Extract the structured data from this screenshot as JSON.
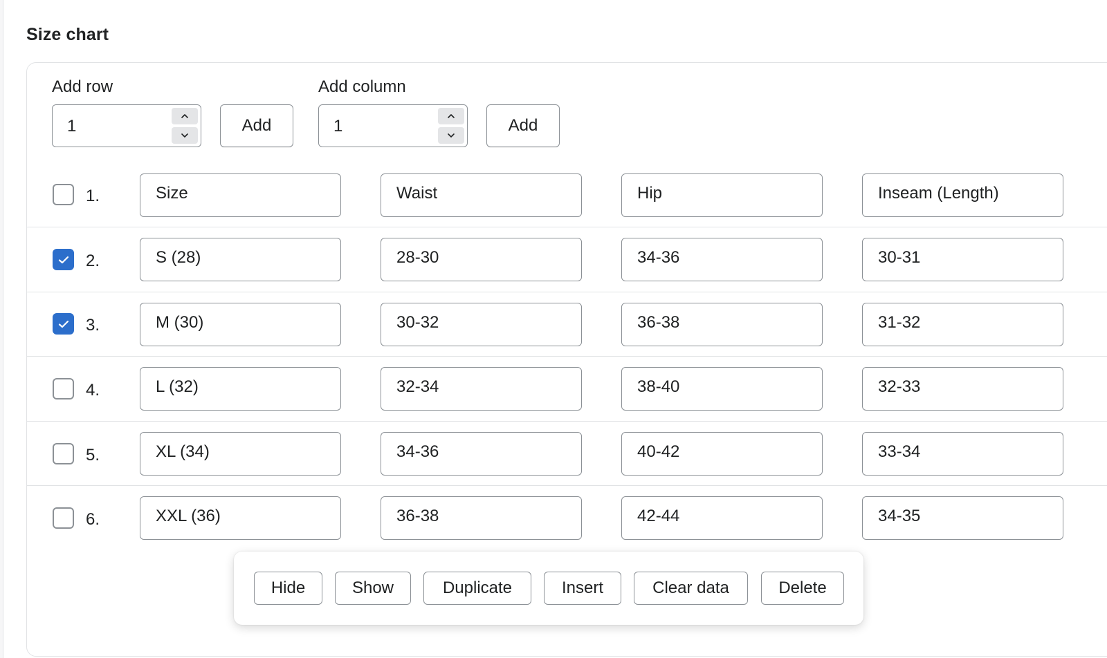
{
  "section_title": "Size chart",
  "controls": {
    "add_row": {
      "label": "Add row",
      "value": "1",
      "button": "Add"
    },
    "add_column": {
      "label": "Add column",
      "value": "1",
      "button": "Add"
    }
  },
  "table": {
    "rows": [
      {
        "num": "1.",
        "checked": false,
        "cells": [
          "Size",
          "Waist",
          "Hip",
          "Inseam (Length)"
        ]
      },
      {
        "num": "2.",
        "checked": true,
        "cells": [
          "S (28)",
          "28-30",
          "34-36",
          "30-31"
        ]
      },
      {
        "num": "3.",
        "checked": true,
        "cells": [
          "M (30)",
          "30-32",
          "36-38",
          "31-32"
        ]
      },
      {
        "num": "4.",
        "checked": false,
        "cells": [
          "L (32)",
          "32-34",
          "38-40",
          "32-33"
        ]
      },
      {
        "num": "5.",
        "checked": false,
        "cells": [
          "XL (34)",
          "34-36",
          "40-42",
          "33-34"
        ]
      },
      {
        "num": "6.",
        "checked": false,
        "cells": [
          "XXL (36)",
          "36-38",
          "42-44",
          "34-35"
        ]
      }
    ]
  },
  "actions": [
    "Hide",
    "Show",
    "Duplicate",
    "Insert",
    "Clear data",
    "Delete"
  ],
  "icons": {
    "spinner_up": "chevron-up-icon",
    "spinner_down": "chevron-down-icon",
    "checkmark": "checkmark-icon"
  },
  "colors": {
    "accent": "#2c6ecb",
    "border": "#8c9196",
    "divider": "#e1e3e5",
    "text": "#202223"
  }
}
